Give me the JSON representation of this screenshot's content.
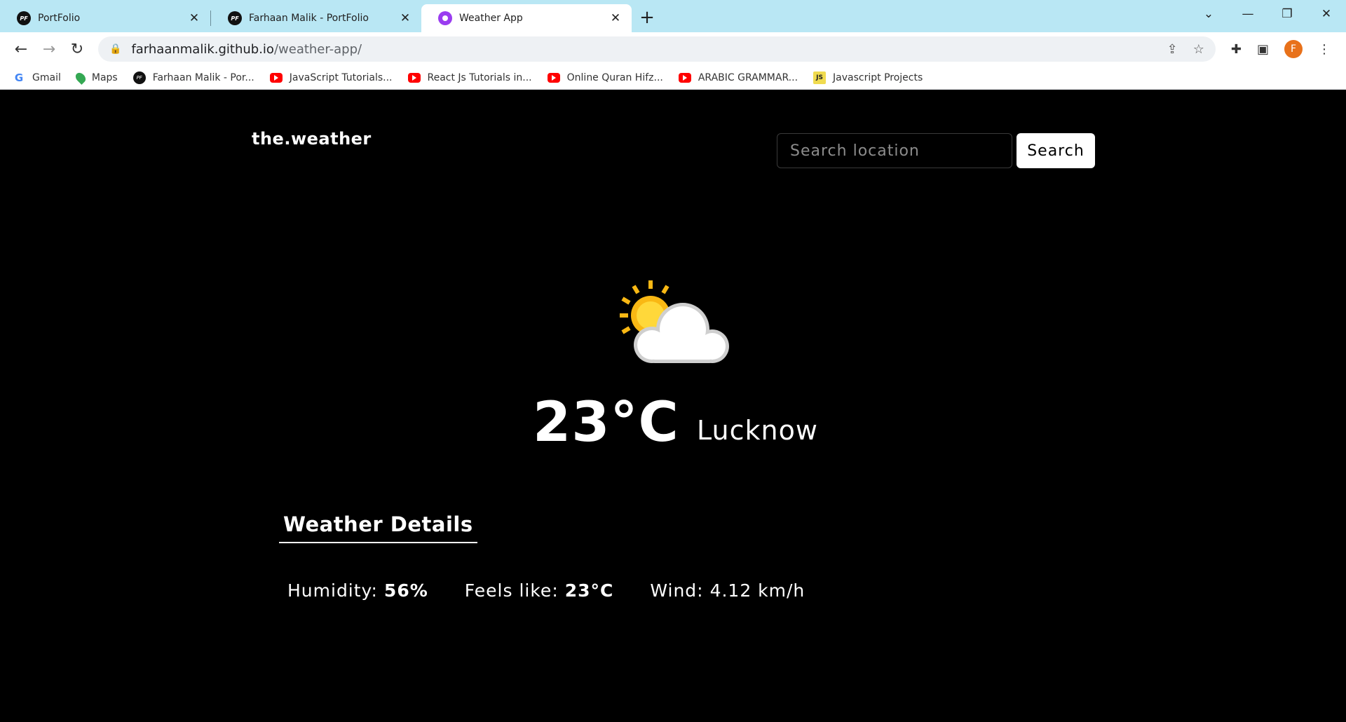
{
  "browser": {
    "tabs": [
      {
        "title": "PortFolio",
        "favicon": "pf-icon",
        "active": false
      },
      {
        "title": "Farhaan Malik - PortFolio",
        "favicon": "pf-icon",
        "active": false
      },
      {
        "title": "Weather App",
        "favicon": "weather-app-icon",
        "active": true
      }
    ],
    "url_host": "farhaanmalik.github.io",
    "url_path": "/weather-app/",
    "profile_initial": "F",
    "bookmarks": [
      {
        "label": "Gmail",
        "icon": "google-icon"
      },
      {
        "label": "Maps",
        "icon": "maps-icon"
      },
      {
        "label": "Farhaan Malik - Por...",
        "icon": "pf-icon"
      },
      {
        "label": "JavaScript Tutorials...",
        "icon": "youtube-icon"
      },
      {
        "label": "React Js Tutorials in...",
        "icon": "youtube-icon"
      },
      {
        "label": "Online Quran Hifz...",
        "icon": "youtube-icon"
      },
      {
        "label": "ARABIC GRAMMAR...",
        "icon": "youtube-icon"
      },
      {
        "label": "Javascript Projects",
        "icon": "js-icon"
      }
    ]
  },
  "app": {
    "logo": "the.weather",
    "search": {
      "placeholder": "Search location",
      "value": "",
      "button_label": "Search"
    },
    "current": {
      "condition_icon": "partly-cloudy-icon",
      "temperature": "23°C",
      "city": "Lucknow"
    },
    "details": {
      "title": "Weather Details",
      "humidity_label": "Humidity:",
      "humidity_value": "56%",
      "feels_like_label": "Feels like:",
      "feels_like_value": "23°C",
      "wind_label": "Wind:",
      "wind_value": "4.12 km/h"
    }
  },
  "colors": {
    "page_bg": "#000000",
    "tabbar_bg": "#b9e7f4",
    "sun": "#f9b814",
    "cloud": "#ffffff"
  }
}
